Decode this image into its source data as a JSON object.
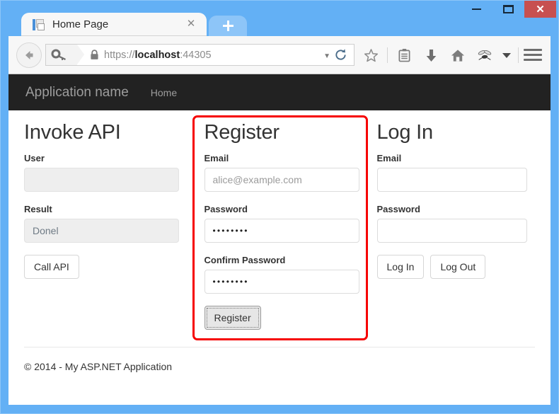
{
  "window": {
    "minimize_label": "–",
    "maximize_label": "□",
    "close_label": "✕"
  },
  "browser": {
    "tab": {
      "title": "Home Page",
      "favicon_name": "page-favicon",
      "close_label": "✕"
    },
    "new_tab_label": "+",
    "back_label": "←",
    "url": {
      "scheme": "https://",
      "host": "localhost",
      "port": ":44305",
      "lock_icon": "padlock-icon",
      "identity_icon": "key-icon",
      "dropdown_label": "▼"
    },
    "toolbar": {
      "reload_label": "↻",
      "icons": [
        {
          "name": "bookmark-star-icon"
        },
        {
          "name": "reader-list-icon"
        },
        {
          "name": "download-arrow-icon"
        },
        {
          "name": "home-icon"
        },
        {
          "name": "fly-icon"
        },
        {
          "name": "overflow-chevron-icon"
        }
      ],
      "menu_label": "menu-icon"
    }
  },
  "site": {
    "brand": "Application name",
    "nav": [
      {
        "label": "Home"
      }
    ],
    "columns": {
      "invoke_api": {
        "title": "Invoke API",
        "user_label": "User",
        "user_value": "",
        "result_label": "Result",
        "result_value": "Donel",
        "call_button": "Call API"
      },
      "register": {
        "title": "Register",
        "email_label": "Email",
        "email_placeholder": "alice@example.com",
        "email_value": "",
        "password_label": "Password",
        "password_value": "••••••••",
        "confirm_label": "Confirm Password",
        "confirm_value": "••••••••",
        "register_button": "Register",
        "highlight_color": "#f60000"
      },
      "login": {
        "title": "Log In",
        "email_label": "Email",
        "email_value": "",
        "password_label": "Password",
        "password_value": "",
        "login_button": "Log In",
        "logout_button": "Log Out"
      }
    },
    "footer": "© 2014 - My ASP.NET Application"
  }
}
